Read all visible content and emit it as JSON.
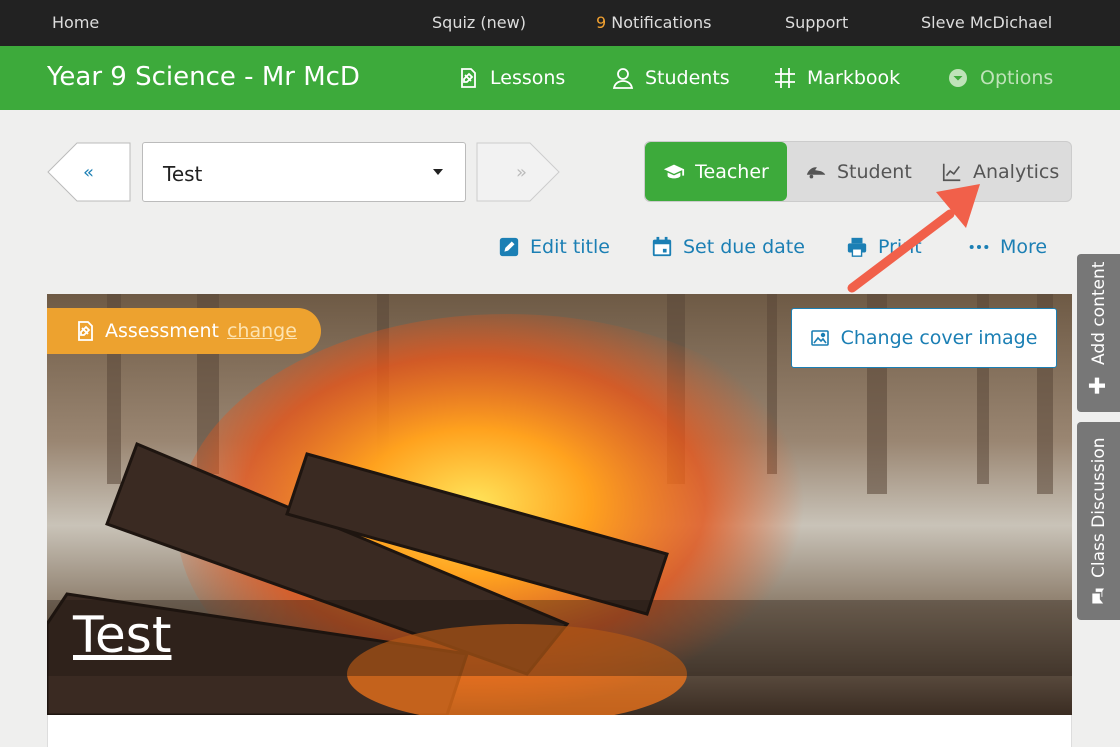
{
  "topbar": {
    "home": "Home",
    "squiz": "Squiz (new)",
    "notifications_count": "9",
    "notifications_label": "Notifications",
    "support": "Support",
    "user": "Sleve McDichael"
  },
  "classbar": {
    "title": "Year 9 Science - Mr McD",
    "lessons": "Lessons",
    "students": "Students",
    "markbook": "Markbook",
    "options": "Options"
  },
  "selector": {
    "prev": "«",
    "next": "»",
    "selected": "Test"
  },
  "modes": {
    "teacher": "Teacher",
    "student": "Student",
    "analytics": "Analytics"
  },
  "actions": {
    "edit_title": "Edit title",
    "set_due_date": "Set due date",
    "print": "Print",
    "more": "More"
  },
  "cover": {
    "badge_label": "Assessment",
    "badge_link": "change",
    "change_cover": "Change cover image",
    "title": "Test"
  },
  "side_tabs": {
    "add_content": "Add content",
    "class_discussion": "Class Discussion"
  },
  "colors": {
    "topbar": "#222222",
    "brand_green": "#3daa3b",
    "link_blue": "#1b7fb4",
    "badge_orange": "#eda22f",
    "arrow_red": "#f1604a"
  }
}
